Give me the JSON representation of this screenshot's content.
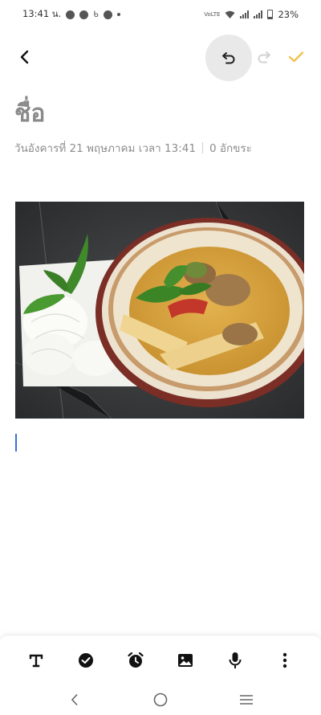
{
  "status_bar": {
    "time": "13:41 น.",
    "battery": "23%",
    "network": "VoLTE"
  },
  "toolbar": {
    "back_icon": "back-arrow-icon",
    "undo_icon": "undo-icon",
    "redo_icon": "redo-icon",
    "done_icon": "checkmark-icon",
    "accent": "#f2c14e"
  },
  "note": {
    "title": "ชื่อ",
    "date": "วันอังคารที่ 21 พฤษภาคม เวลา 13:41",
    "char_count": "0 อักขระ"
  },
  "bottom_tools": [
    {
      "name": "text-format-icon"
    },
    {
      "name": "checklist-icon"
    },
    {
      "name": "alarm-icon"
    },
    {
      "name": "image-icon"
    },
    {
      "name": "microphone-icon"
    },
    {
      "name": "more-options-icon"
    }
  ],
  "nav": {
    "back": "nav-back-icon",
    "home": "nav-home-icon",
    "recents": "nav-recents-icon"
  }
}
